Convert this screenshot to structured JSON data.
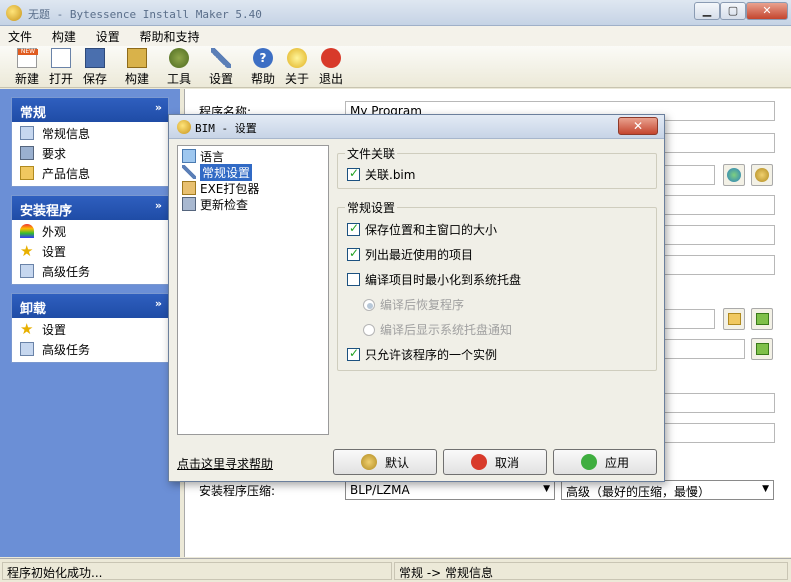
{
  "window": {
    "title": "无题 - Bytessence Install Maker 5.40"
  },
  "menu": [
    "文件",
    "构建",
    "设置",
    "帮助和支持"
  ],
  "toolbar": [
    "新建",
    "打开",
    "保存",
    "构建",
    "工具",
    "设置",
    "帮助",
    "关于",
    "退出"
  ],
  "sidebar": {
    "general": {
      "title": "常规",
      "items": [
        "常规信息",
        "要求",
        "产品信息"
      ]
    },
    "installer": {
      "title": "安装程序",
      "items": [
        "外观",
        "设置",
        "高级任务"
      ]
    },
    "uninstall": {
      "title": "卸载",
      "items": [
        "设置",
        "高级任务"
      ]
    }
  },
  "main": {
    "program_name_label": "程序名称:",
    "program_name_value": "My Program",
    "compression_label": "安装程序压缩:",
    "compression_algo": "BLP/LZMA",
    "compression_level": "高级（最好的压缩，最慢）"
  },
  "status": {
    "left": "程序初始化成功...",
    "right": "常规 -> 常规信息"
  },
  "dialog": {
    "title": "BIM - 设置",
    "tree": [
      "语言",
      "常规设置",
      "EXE打包器",
      "更新检查"
    ],
    "file_assoc_title": "文件关联",
    "assoc_bim": "关联.bim",
    "general_title": "常规设置",
    "options": [
      "保存位置和主窗口的大小",
      "列出最近使用的项目",
      "编译项目时最小化到系统托盘"
    ],
    "radios": [
      "编译后恢复程序",
      "编译后显示系统托盘通知"
    ],
    "single_instance": "只允许该程序的一个实例",
    "help_link": "点击这里寻求帮助",
    "buttons": {
      "default": "默认",
      "cancel": "取消",
      "apply": "应用"
    }
  }
}
